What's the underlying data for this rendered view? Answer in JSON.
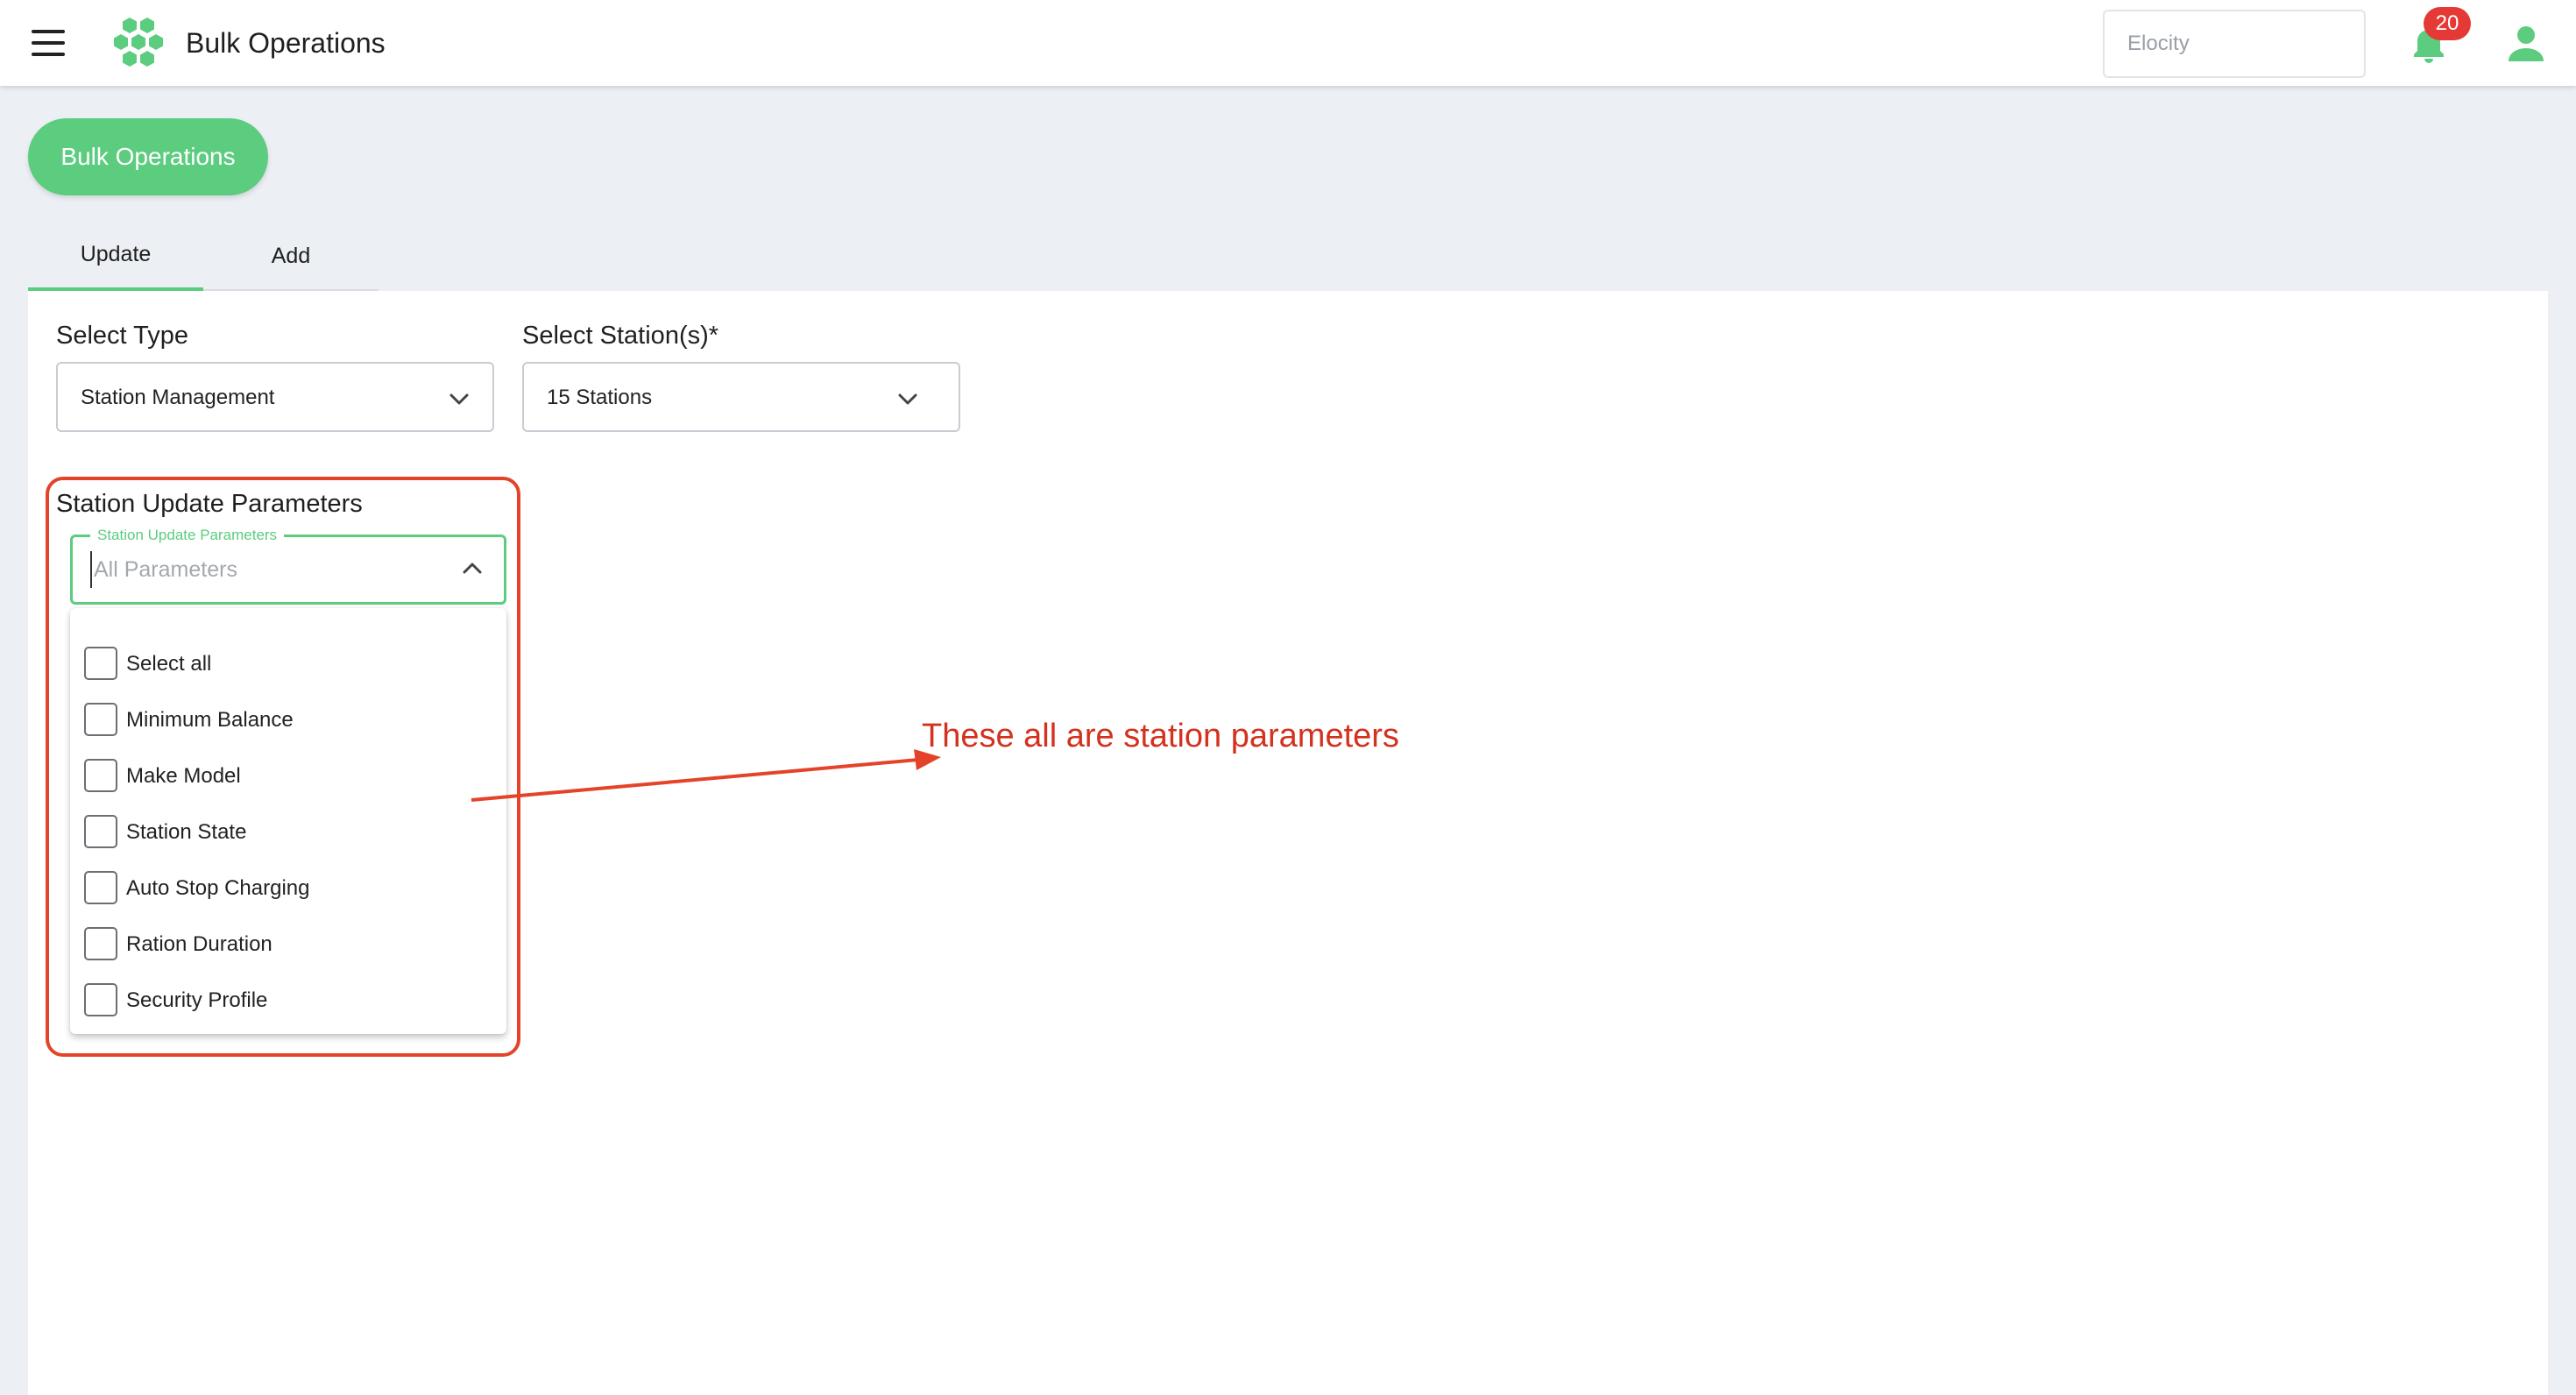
{
  "header": {
    "app_title": "Bulk Operations",
    "org_placeholder": "Elocity",
    "notification_count": "20",
    "icons": {
      "menu": "hamburger-menu-icon",
      "logo": "hexagon-cluster-logo",
      "bell": "bell-icon",
      "user": "user-icon"
    },
    "colors": {
      "brand": "#5ccc7f",
      "badge": "#e53935"
    }
  },
  "page": {
    "heading_pill": "Bulk Operations",
    "tabs": [
      {
        "label": "Update",
        "active": true
      },
      {
        "label": "Add",
        "active": false
      }
    ]
  },
  "form": {
    "select_type": {
      "label": "Select Type",
      "value": "Station Management"
    },
    "select_stations": {
      "label": "Select Station(s)*",
      "value": "15 Stations"
    },
    "params": {
      "section_label": "Station Update Parameters",
      "floating_label": "Station Update Parameters",
      "placeholder": "All Parameters",
      "options": [
        {
          "label": "Select all",
          "checked": false
        },
        {
          "label": "Minimum Balance",
          "checked": false
        },
        {
          "label": "Make Model",
          "checked": false
        },
        {
          "label": "Station State",
          "checked": false
        },
        {
          "label": "Auto Stop Charging",
          "checked": false
        },
        {
          "label": "Ration Duration",
          "checked": false
        },
        {
          "label": "Security Profile",
          "checked": false
        }
      ]
    }
  },
  "annotation": {
    "text": "These all are station parameters",
    "color": "#d3321e"
  }
}
